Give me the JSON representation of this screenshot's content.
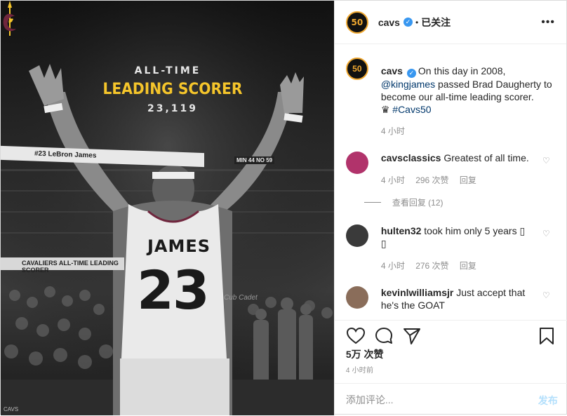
{
  "poster": {
    "kicker": "ALL-TIME",
    "title": "LEADING SCORER",
    "number": "23,119",
    "banner_top": "#23 LeBron James",
    "banner_bottom": "CAVALIERS ALL-TIME LEADING SCORER",
    "jersey_name": "JAMES",
    "jersey_number": "23",
    "court_ad": "Cub Cadet",
    "score_sign": "MIN 44 NO 59",
    "watermark": "CAVS",
    "colors": {
      "gold": "#f5c52b",
      "wine": "#6f263d"
    }
  },
  "header": {
    "username": "cavs",
    "avatar_text": "50",
    "dot": "•",
    "follow_label": "已关注",
    "more_icon": "more-horizontal-icon"
  },
  "caption": {
    "username": "cavs",
    "text_1": "On this day in 2008,",
    "mention": "@kingjames",
    "text_2": "passed Brad Daugherty to become our all-time leading scorer.",
    "emoji": "♛",
    "hashtag": "#Cavs50",
    "time": "4 小时"
  },
  "comments": [
    {
      "username": "cavsclassics",
      "text": "Greatest of all time.",
      "time": "4 小时",
      "likes": "296 次赞",
      "reply": "回复",
      "view_replies": "查看回复 (12)",
      "avatar_color": "#b1336b"
    },
    {
      "username": "hulten32",
      "text": "took him only 5 years",
      "glyph": "▯",
      "glyph2": "▯",
      "time": "4 小时",
      "likes": "276 次赞",
      "reply": "回复",
      "avatar_color": "#3a3a3a"
    },
    {
      "username": "kevinlwilliamsjr",
      "text": "Just accept that he's the GOAT",
      "avatar_color": "#8a6d5a"
    }
  ],
  "actions": {
    "like_icon": "heart-outline-icon",
    "comment_icon": "comment-bubble-icon",
    "share_icon": "paper-plane-icon",
    "save_icon": "bookmark-icon",
    "likes": "5万 次赞",
    "posted": "4 小时前"
  },
  "composer": {
    "placeholder": "添加评论...",
    "post_label": "发布"
  }
}
